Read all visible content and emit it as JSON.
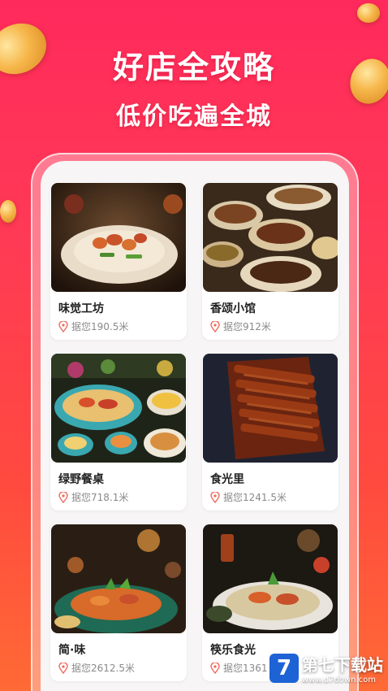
{
  "hero": {
    "title": "好店全攻略",
    "subtitle": "低价吃遍全城"
  },
  "colors": {
    "background_top": "#ff2a5c",
    "background_bottom": "#ff6a35",
    "card_bg": "#ffffff",
    "screen_bg": "#f7f5f5",
    "pin_color": "#f06a5a"
  },
  "restaurants": [
    {
      "name": "味觉工坊",
      "distance": "据您190.5米",
      "icon": "location-pin-icon"
    },
    {
      "name": "香颂小馆",
      "distance": "据您912米",
      "icon": "location-pin-icon"
    },
    {
      "name": "绿野餐桌",
      "distance": "据您718.1米",
      "icon": "location-pin-icon"
    },
    {
      "name": "食光里",
      "distance": "据您1241.5米",
      "icon": "location-pin-icon"
    },
    {
      "name": "简·味",
      "distance": "据您2612.5米",
      "icon": "location-pin-icon"
    },
    {
      "name": "筷乐食光",
      "distance": "据您1361",
      "icon": "location-pin-icon"
    }
  ],
  "watermark": {
    "logo": "7",
    "title": "第七下载站",
    "url": "www.d7down.com"
  }
}
